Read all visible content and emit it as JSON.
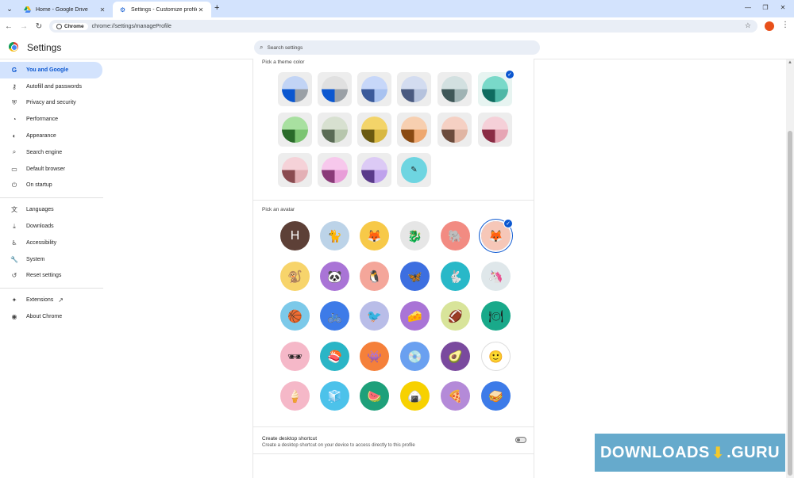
{
  "browser": {
    "tabs": [
      {
        "title": "Home - Google Drive",
        "active": false
      },
      {
        "title": "Settings - Customize profile",
        "active": true
      }
    ],
    "omnibox": {
      "chip": "Chrome",
      "url": "chrome://settings/manageProfile"
    }
  },
  "settings": {
    "title": "Settings",
    "search_placeholder": "Search settings"
  },
  "sidebar": {
    "items": [
      {
        "label": "You and Google",
        "icon": "G",
        "active": true
      },
      {
        "label": "Autofill and passwords",
        "icon": "⚷"
      },
      {
        "label": "Privacy and security",
        "icon": "⛨"
      },
      {
        "label": "Performance",
        "icon": "◔"
      },
      {
        "label": "Appearance",
        "icon": "◐"
      },
      {
        "label": "Search engine",
        "icon": "⌕"
      },
      {
        "label": "Default browser",
        "icon": "▭"
      },
      {
        "label": "On startup",
        "icon": "⏻"
      }
    ],
    "items2": [
      {
        "label": "Languages",
        "icon": "文"
      },
      {
        "label": "Downloads",
        "icon": "⤓"
      },
      {
        "label": "Accessibility",
        "icon": "♿"
      },
      {
        "label": "System",
        "icon": "🔧"
      },
      {
        "label": "Reset settings",
        "icon": "↺"
      }
    ],
    "items3": [
      {
        "label": "Extensions",
        "icon": "✦"
      },
      {
        "label": "About Chrome",
        "icon": "◉"
      }
    ]
  },
  "main": {
    "theme_label": "Pick a theme color",
    "avatar_label": "Pick an avatar",
    "avatar_letter": "H",
    "shortcut_title": "Create desktop shortcut",
    "shortcut_desc": "Create a desktop shortcut on your device to access directly to this profile"
  },
  "watermark": {
    "left": "DOWNLOADS",
    "right": ".GURU"
  }
}
